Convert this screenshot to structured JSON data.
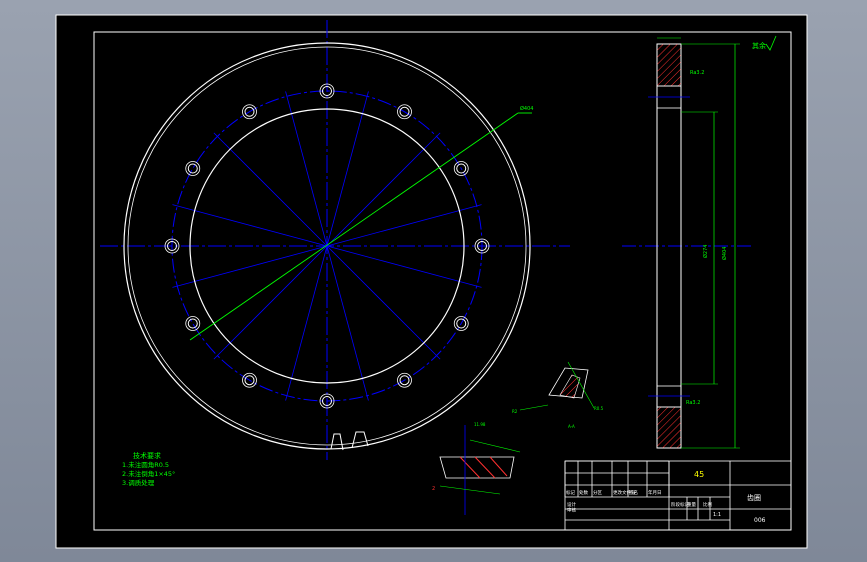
{
  "drawing": {
    "background_color": "#000000",
    "geometry_color": "#ffffff",
    "center_line_color": "#0000ff",
    "dimension_color": "#00ff00",
    "section_hatch_color": "#ff0000"
  },
  "tech_requirements": {
    "title": "技术要求",
    "lines": [
      "1.未注圆角R0.5",
      "2.未注倒角1×45°",
      "3.调质处理"
    ]
  },
  "roughness_note": "其余",
  "title_block": {
    "material": "45",
    "part_name": "齿圈",
    "drawing_no": "006",
    "scale": "1:1",
    "row_labels": [
      "标记",
      "处数",
      "分区",
      "更改文件号",
      "签名",
      "年月日"
    ],
    "sign_labels": [
      "设计",
      "审核",
      "工艺",
      "标准化",
      "批准"
    ],
    "stage_labels": [
      "阶段标记",
      "重量",
      "比例"
    ]
  }
}
